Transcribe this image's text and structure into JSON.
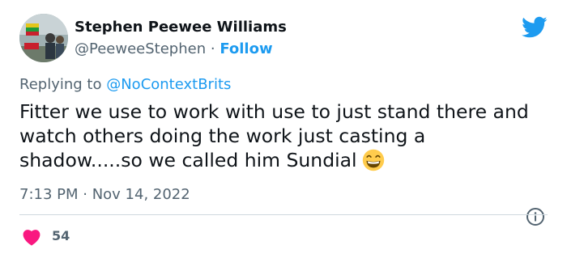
{
  "author": {
    "display_name": "Stephen Peewee Williams",
    "handle": "@PeeweeStephen",
    "separator": "·",
    "follow_label": "Follow"
  },
  "reply": {
    "prefix": "Replying to",
    "mention": "@NoContextBrits"
  },
  "tweet": {
    "text": "Fitter we use to work with use to just stand there and watch others doing the work just casting a shadow.....so we called him Sundial",
    "emoji": "grinning-face-with-smiling-eyes",
    "timestamp": "7:13 PM · Nov 14, 2022"
  },
  "engagement": {
    "likes": "54"
  },
  "colors": {
    "accent": "#1d9bf0",
    "like": "#f91880",
    "muted": "#536471"
  }
}
